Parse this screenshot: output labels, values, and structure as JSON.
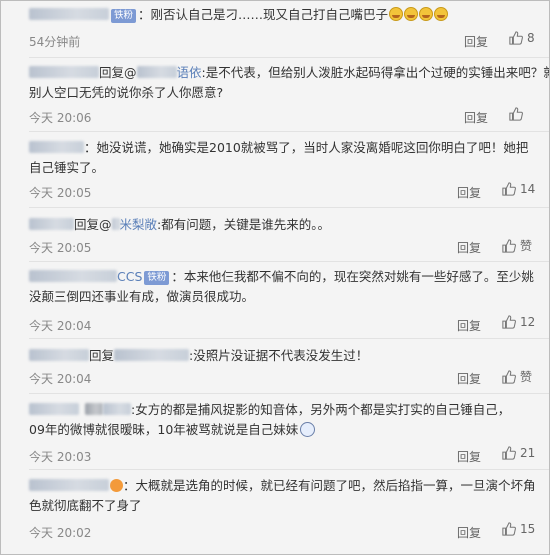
{
  "comments": [
    {
      "fans_badge": "铁粉",
      "text": "：刚否认自己是刁……现又自己打自己嘴巴子",
      "time": "54分钟前",
      "reply_label": "回复",
      "likes": "8",
      "icon": "laugh-cry-emoji"
    },
    {
      "reply_prefix": "回复@",
      "mention_tail": "语依",
      "line1": ":是不代表，但给别人泼脏水起码得拿出个过硬的实锤出来吧？就像",
      "line2": "别人空口无凭的说你杀了人你愿意?",
      "time": "今天 20:06",
      "reply_label": "回复",
      "likes": ""
    },
    {
      "line1": "：她没说谎，她确实是2010就被骂了，当时人家没离婚呢这回你明白了吧！她把",
      "line2": "自己锤实了。",
      "time": "今天 20:05",
      "reply_label": "回复",
      "likes": "14"
    },
    {
      "reply_prefix": "回复@",
      "mention_tail": "米梨敞",
      "line1": ":都有问题，关键是谁先来的。。",
      "time": "今天 20:05",
      "reply_label": "回复",
      "likes": "赞"
    },
    {
      "nick_tail": "CCS",
      "fans_badge": "铁粉",
      "line1": "：本来他仨我都不偏不向的，现在突然对姚有一些好感了。至少姚",
      "line2": "没颠三倒四还事业有成，做演员很成功。",
      "time": "今天 20:04",
      "reply_label": "回复",
      "likes": "12"
    },
    {
      "reply_prefix": "回复",
      "line1": ":没照片没证据不代表没发生过！",
      "time": "今天 20:04",
      "reply_label": "回复",
      "likes": "赞"
    },
    {
      "line1": ":女方的都是捕风捉影的知音体，另外两个都是实打实的自己锤自己，",
      "line2": "09年的微博就很暧昧，10年被骂就说是自己妹妹",
      "time": "今天 20:03",
      "reply_label": "回复",
      "likes": "21",
      "icon": "weibo-emoji"
    },
    {
      "line1": "：大概就是选角的时候，就已经有问题了吧，然后掐指一算，一旦演个坏角",
      "line2": "色就彻底翻不了身了",
      "time": "今天 20:02",
      "reply_label": "回复",
      "likes": "15"
    }
  ],
  "colors": {
    "link": "#5a7fb8",
    "fans_badge": "#7d9ad4",
    "time": "#888888",
    "background": "#f4f4f4"
  }
}
